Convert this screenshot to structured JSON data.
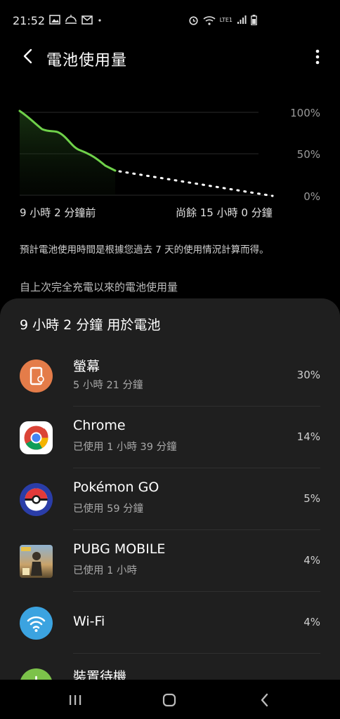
{
  "status": {
    "time": "21:52",
    "network_label": "LTE1"
  },
  "header": {
    "title": "電池使用量"
  },
  "chart": {
    "left_label": "9 小時 2 分鐘前",
    "right_label": "尚餘 15 小時 0 分鐘",
    "y_ticks": [
      "100%",
      "50%",
      "0%"
    ],
    "accent_color": "#6fd14a"
  },
  "note": "預計電池使用時間是根據您過去 7 天的使用情況計算而得。",
  "section_heading": "自上次完全充電以來的電池使用量",
  "sheet": {
    "title": "9 小時 2 分鐘 用於電池",
    "apps": [
      {
        "name": "螢幕",
        "sub": "5 小時 21 分鐘",
        "pct": "30%",
        "icon": "screen-icon"
      },
      {
        "name": "Chrome",
        "sub": "已使用 1 小時 39 分鐘",
        "pct": "14%",
        "icon": "chrome-icon"
      },
      {
        "name": "Pokémon GO",
        "sub": "已使用 59 分鐘",
        "pct": "5%",
        "icon": "pokeball-icon"
      },
      {
        "name": "PUBG MOBILE",
        "sub": "已使用 1 小時",
        "pct": "4%",
        "icon": "pubg-icon"
      },
      {
        "name": "Wi-Fi",
        "sub": "",
        "pct": "4%",
        "icon": "wifi-icon"
      },
      {
        "name": "裝置待機",
        "sub": "",
        "pct": "",
        "icon": "power-icon"
      }
    ]
  }
}
